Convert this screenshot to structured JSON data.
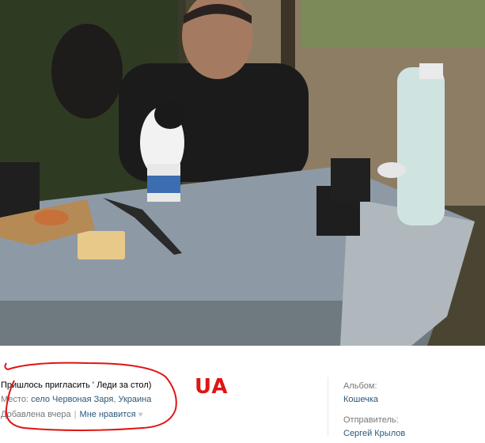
{
  "photo": {
    "alt_icon": "photo-image"
  },
  "caption": {
    "text": "Пришлось пригласить ' Леди за стол)"
  },
  "place": {
    "label": "Место:",
    "village": "село Червоная Заря",
    "separator": ",",
    "country": "Украина"
  },
  "meta": {
    "added": "Добавлена вчера",
    "separator": "|",
    "like": "Мне нравится"
  },
  "album": {
    "label": "Альбом:",
    "name": "Кошечка"
  },
  "sender": {
    "label": "Отправитель:",
    "name": "Сергей Крылов"
  },
  "annotation": {
    "text": "UA",
    "color": "#e01414"
  },
  "colors": {
    "link": "#2b587a",
    "muted": "#777777"
  }
}
